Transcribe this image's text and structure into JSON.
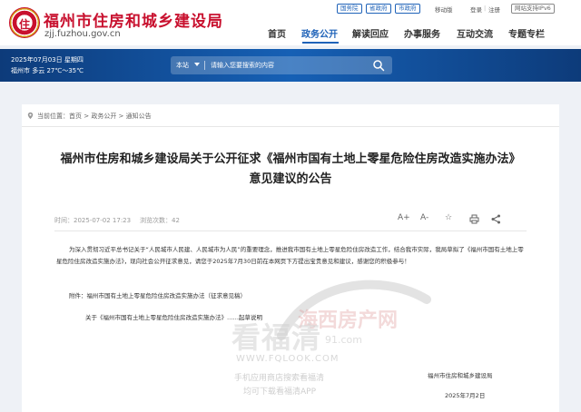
{
  "header": {
    "logo_text": "住",
    "site_title": "福州市住房和城乡建设局",
    "site_domain": "zjj.fuzhou.gov.cn",
    "top_links": {
      "national_portal": "国务院",
      "provincial_portal": "省政府",
      "city_portal": "市政府",
      "mobile": "移动版",
      "login": "登录",
      "register": "注册",
      "ipv6": "网站支持IPv6"
    },
    "nav": [
      "首页",
      "政务公开",
      "解读回应",
      "办事服务",
      "互动交流",
      "专题专栏"
    ],
    "active_nav": "政务公开"
  },
  "banner": {
    "date": "2025年07月03日 星期四",
    "weather": "福州市 多云 27℃～35℃",
    "search": {
      "scope": "本站",
      "placeholder": "请输入您要搜索的内容"
    }
  },
  "breadcrumb": {
    "label": "当前位置：",
    "items": [
      "首页",
      "政务公开",
      "通知公告"
    ],
    "separator": " > "
  },
  "article": {
    "title": "福州市住房和城乡建设局关于公开征求《福州市国有土地上零星危险住房改造实施办法》意见建议的公告",
    "time_label": "时间：",
    "time": "2025-07-02 17:23",
    "views_label": "浏览次数：",
    "views": "42",
    "tools": [
      "A+",
      "A-",
      "☆",
      "打印",
      "分享"
    ],
    "paragraph1": "为深入贯彻习近平总书记关于“人民城市人民建、人民城市为人民”的重要理念，推进我市国有土地上零星危险住房改造工作，结合我市实际，我局草拟了《福州市国有土地上零星危险住房改造实施办法》，现向社会公开征求意见，请您于2025年7月30日前在本网页下方提出宝贵意见和建议，感谢您的积极参与！",
    "attachment_label": "附件：",
    "attachment": "福州市国有土地上零星危险住房改造实施办法（征求意见稿）",
    "related_line": "关于《福州市国有土地上零星危险住房改造实施办法》……起草说明",
    "signature": "福州市住房和城乡建设局",
    "date": "2025年7月2日"
  },
  "watermark": {
    "brand_cn": "看福清",
    "brand_overlay": "海西房产网",
    "domain_small": "91.com",
    "url": "WWW.FQLOOK.COM",
    "line1": "手机应用商店搜索看福清",
    "line2": "均可下载看福清APP"
  },
  "colors": {
    "brand_red": "#c8102e",
    "brand_blue": "#1e62b8",
    "banner_dark": "#0d3b7a"
  }
}
